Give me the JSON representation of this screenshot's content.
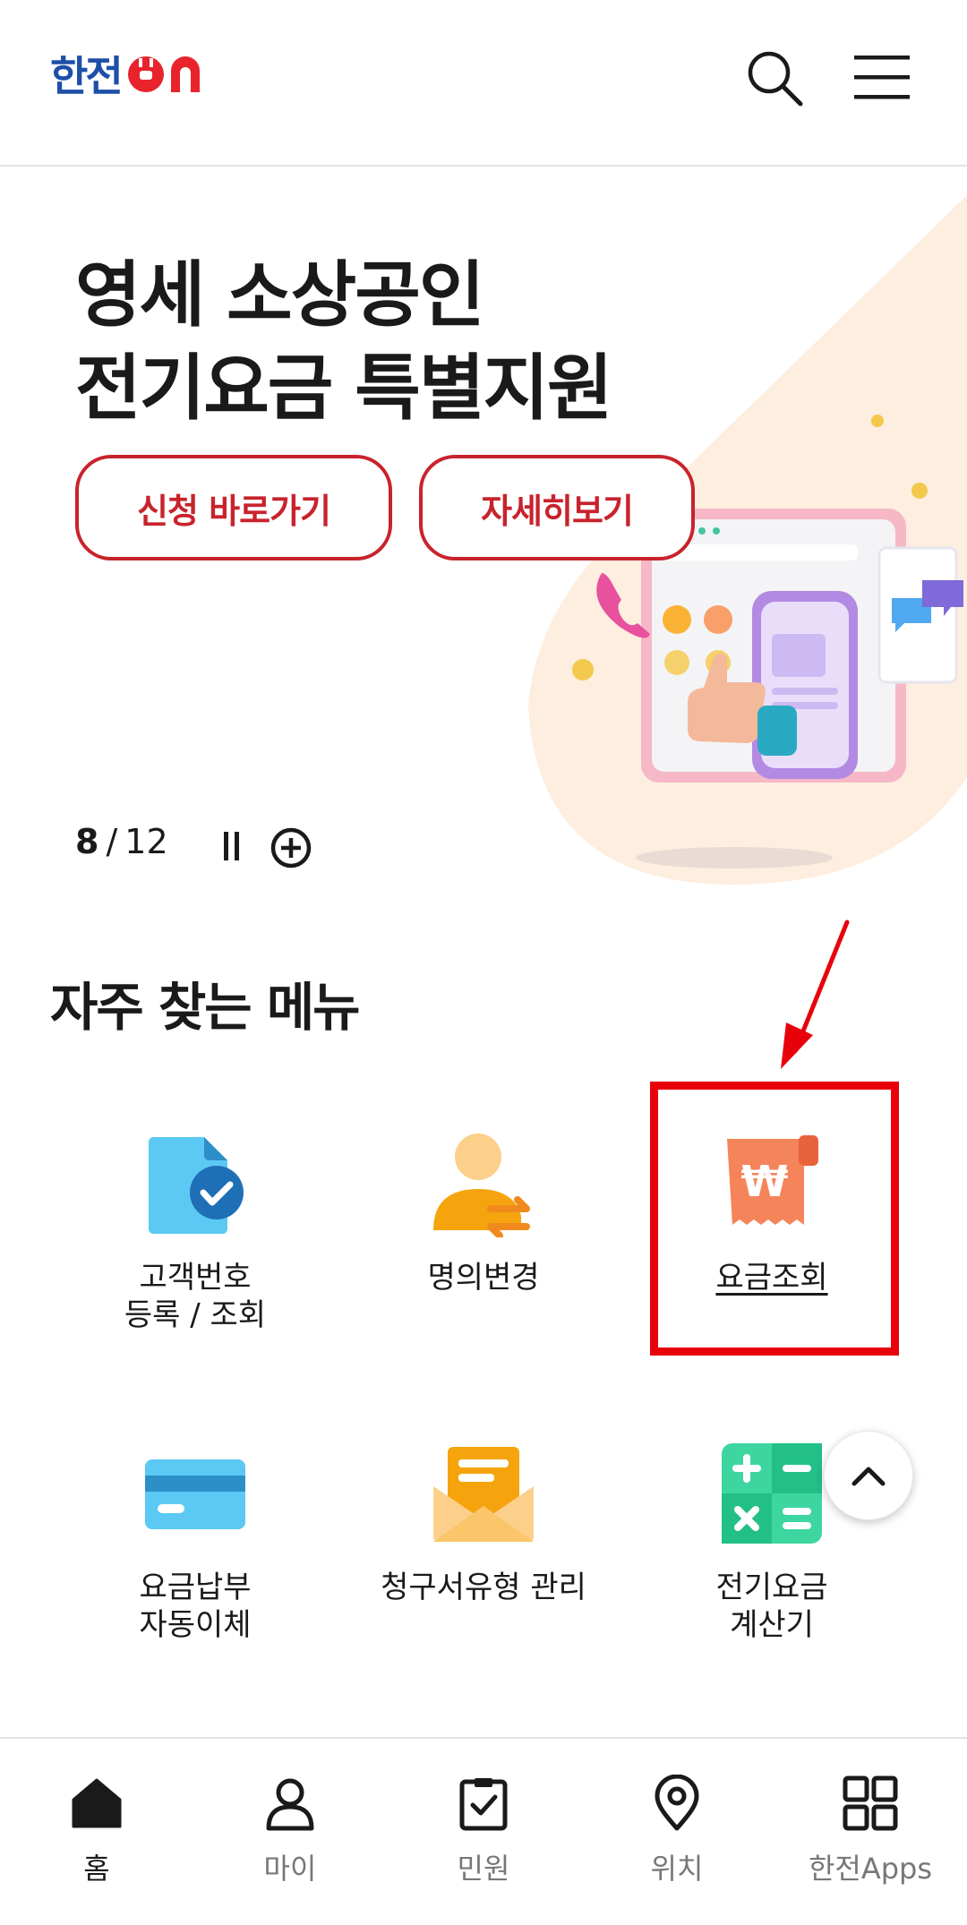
{
  "header": {
    "logo_text": "한전",
    "logo_on": "On",
    "search_icon": "search-icon",
    "menu_icon": "hamburger-icon"
  },
  "banner": {
    "title_line1": "영세 소상공인",
    "title_line2": "전기요금 특별지원",
    "apply_button": "신청 바로가기",
    "detail_button": "자세히보기",
    "current_slide": "8",
    "separator": "/",
    "total_slides": "12",
    "accent_color": "#c8232c"
  },
  "frequent_menu": {
    "title": "자주 찾는 메뉴",
    "items": [
      {
        "label": "고객번호\n등록 / 조회",
        "icon": "document-check-icon"
      },
      {
        "label": "명의변경",
        "icon": "user-transfer-icon"
      },
      {
        "label": "요금조회",
        "icon": "won-receipt-icon"
      },
      {
        "label": "요금납부\n자동이체",
        "icon": "credit-card-icon"
      },
      {
        "label": "청구서유형 관리",
        "icon": "envelope-icon"
      },
      {
        "label": "전기요금\n계산기",
        "icon": "calculator-icon"
      }
    ]
  },
  "bottom_nav": {
    "items": [
      {
        "label": "홈",
        "icon": "home-icon"
      },
      {
        "label": "마이",
        "icon": "user-icon"
      },
      {
        "label": "민원",
        "icon": "clipboard-check-icon"
      },
      {
        "label": "위치",
        "icon": "location-pin-icon"
      },
      {
        "label": "한전Apps",
        "icon": "apps-grid-icon"
      }
    ]
  }
}
